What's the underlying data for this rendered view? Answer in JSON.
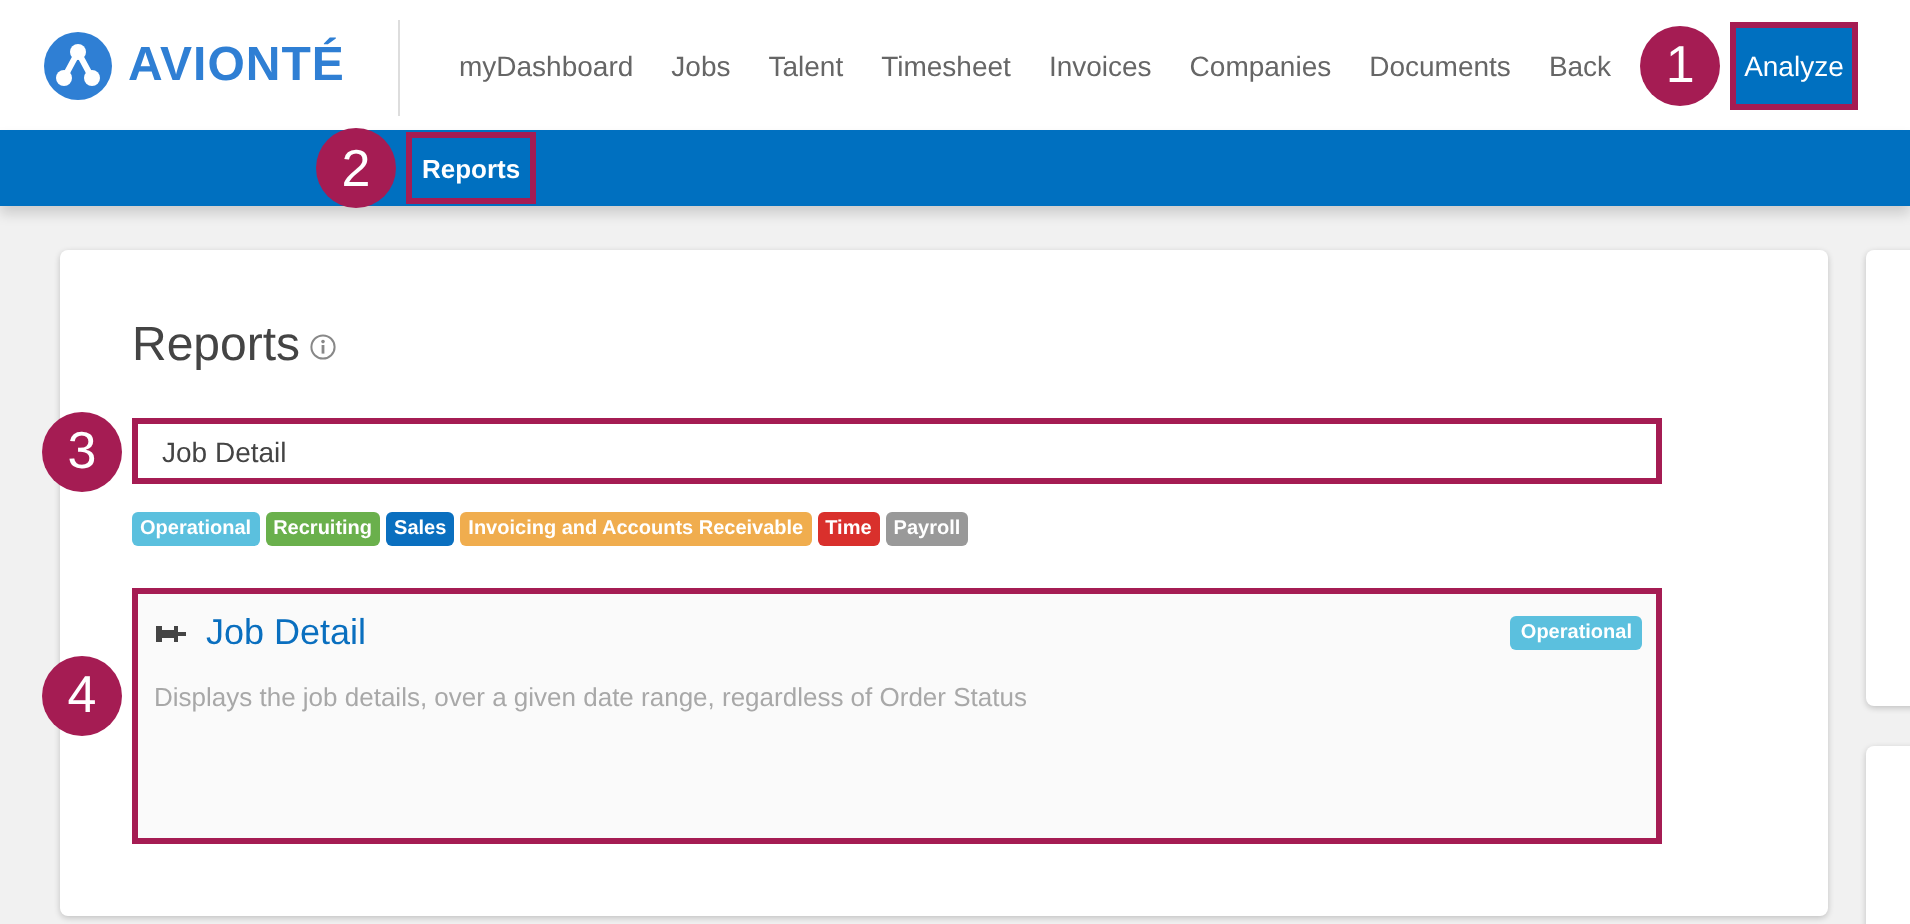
{
  "logo": {
    "text": "AVIONTÉ"
  },
  "nav": [
    {
      "label": "myDashboard",
      "selected": false
    },
    {
      "label": "Jobs",
      "selected": false
    },
    {
      "label": "Talent",
      "selected": false
    },
    {
      "label": "Timesheet",
      "selected": false
    },
    {
      "label": "Invoices",
      "selected": false
    },
    {
      "label": "Companies",
      "selected": false
    },
    {
      "label": "Documents",
      "selected": false
    },
    {
      "label": "Back",
      "selected": false
    },
    {
      "label": "Analyze",
      "selected": true,
      "callout": "1"
    }
  ],
  "subnav": [
    {
      "label": "Reports",
      "callout": "2"
    }
  ],
  "page": {
    "title": "Reports",
    "search": {
      "value": "Job Detail",
      "callout": "3"
    },
    "tags": [
      {
        "label": "Operational",
        "color": "#5bc0de"
      },
      {
        "label": "Recruiting",
        "color": "#6ab04c"
      },
      {
        "label": "Sales",
        "color": "#0a6fbf"
      },
      {
        "label": "Invoicing and Accounts Receivable",
        "color": "#f0ad4e"
      },
      {
        "label": "Time",
        "color": "#d9302c"
      },
      {
        "label": "Payroll",
        "color": "#999999"
      }
    ],
    "results": [
      {
        "title": "Job Detail",
        "description": "Displays the job details, over a given date range, regardless of Order Status",
        "tag": {
          "label": "Operational",
          "color": "#5bc0de"
        },
        "callout": "4"
      }
    ]
  }
}
